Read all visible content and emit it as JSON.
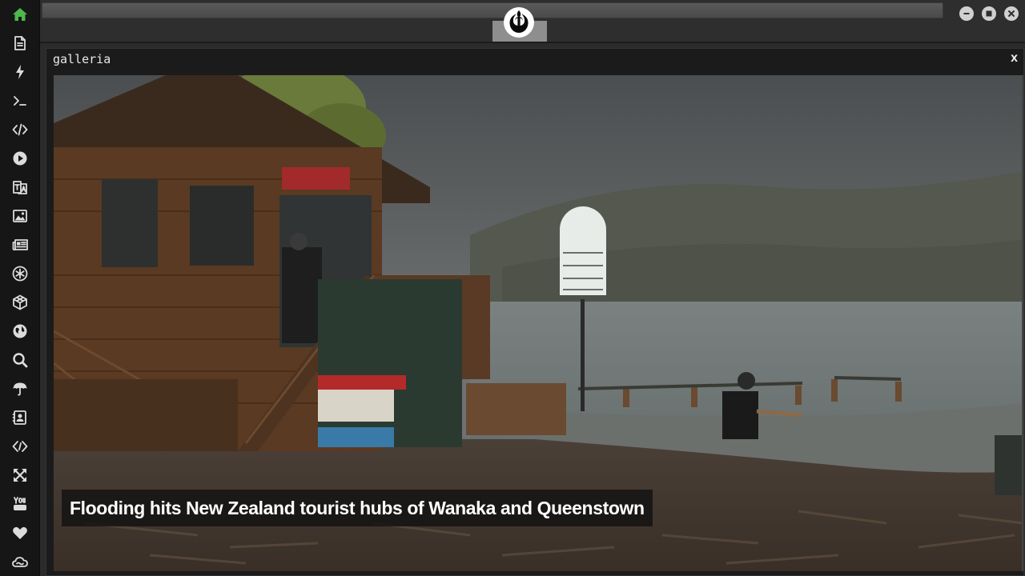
{
  "sidebar": {
    "items": [
      {
        "icon": "home-icon",
        "name": "sidebar-item-home"
      },
      {
        "icon": "document-icon",
        "name": "sidebar-item-document"
      },
      {
        "icon": "lightning-icon",
        "name": "sidebar-item-lightning"
      },
      {
        "icon": "terminal-icon",
        "name": "sidebar-item-terminal"
      },
      {
        "icon": "code-icon",
        "name": "sidebar-item-code"
      },
      {
        "icon": "play-icon",
        "name": "sidebar-item-play"
      },
      {
        "icon": "translate-icon",
        "name": "sidebar-item-translate"
      },
      {
        "icon": "image-icon",
        "name": "sidebar-item-image"
      },
      {
        "icon": "newspaper-icon",
        "name": "sidebar-item-news"
      },
      {
        "icon": "asterisk-icon",
        "name": "sidebar-item-asterisk"
      },
      {
        "icon": "cube-icon",
        "name": "sidebar-item-cube"
      },
      {
        "icon": "globe-icon",
        "name": "sidebar-item-globe"
      },
      {
        "icon": "search-icon",
        "name": "sidebar-item-search"
      },
      {
        "icon": "umbrella-icon",
        "name": "sidebar-item-umbrella"
      },
      {
        "icon": "contact-icon",
        "name": "sidebar-item-contact"
      },
      {
        "icon": "code-tag-icon",
        "name": "sidebar-item-code-tag"
      },
      {
        "icon": "expand-icon",
        "name": "sidebar-item-expand"
      },
      {
        "icon": "youtube-icon",
        "name": "sidebar-item-youtube"
      },
      {
        "icon": "heart-icon",
        "name": "sidebar-item-heart"
      },
      {
        "icon": "cloud-icon",
        "name": "sidebar-item-cloud"
      }
    ],
    "active_color": "#4cb84c",
    "icon_color": "#dcdcdc"
  },
  "topbar": {
    "address_value": "",
    "emblem_icon": "rebel-alliance-emblem-icon",
    "window_buttons": [
      "minimize-icon",
      "maximize-icon",
      "close-icon"
    ]
  },
  "panel": {
    "title": "galleria",
    "close_label": "x"
  },
  "gallery": {
    "caption": "Flooding hits New Zealand tourist hubs of Wanaka and Queenstown"
  }
}
